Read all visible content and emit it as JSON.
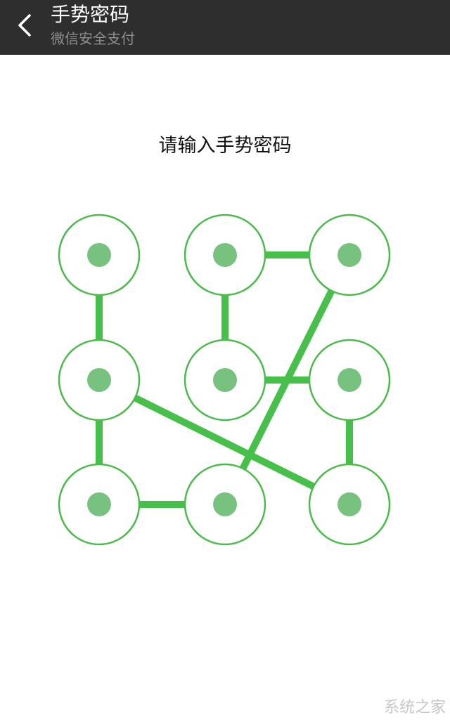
{
  "header": {
    "title": "手势密码",
    "subtitle": "微信安全支付",
    "back_icon": "chevron-left-icon"
  },
  "prompt": "请输入手势密码",
  "pattern": {
    "grid_size": 3,
    "ring_color": "#4cbb4c",
    "dot_color": "#78c27f",
    "line_color": "#46c04a",
    "path": [
      1,
      4,
      7,
      8,
      3,
      2,
      5,
      6,
      9,
      4
    ]
  },
  "watermark": "系统之家"
}
